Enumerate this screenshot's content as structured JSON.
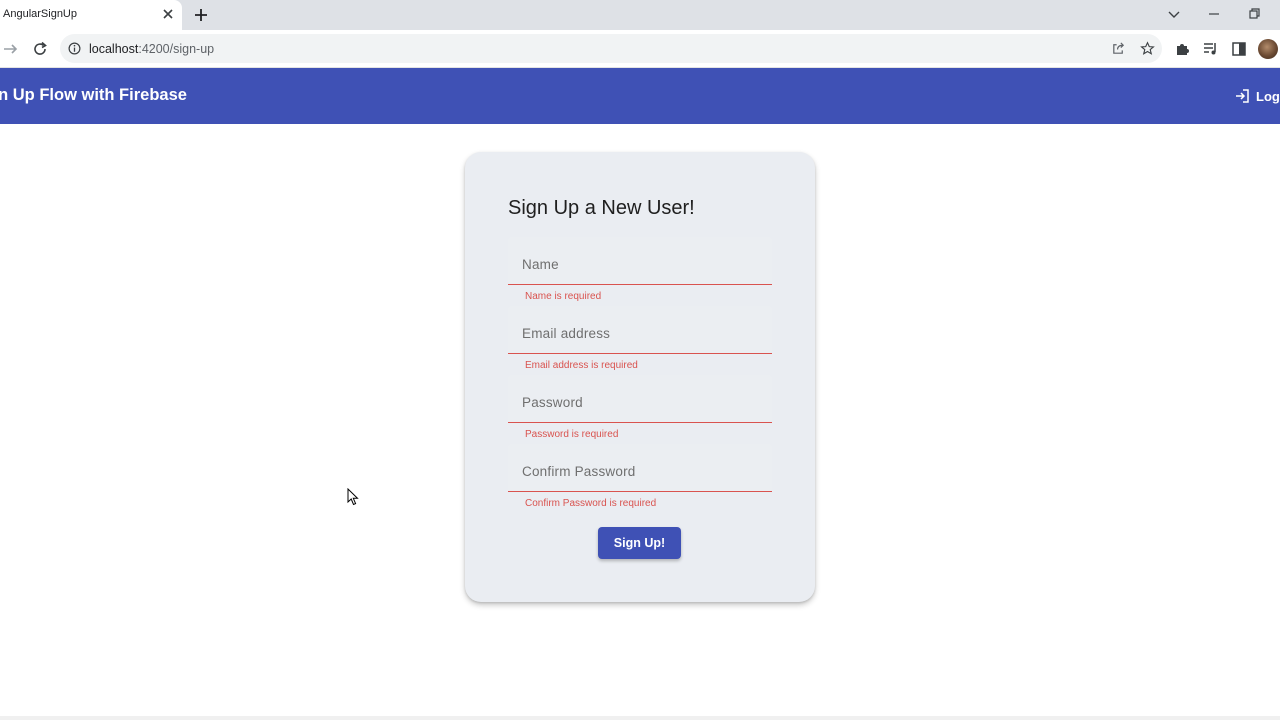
{
  "browser": {
    "tab_title": "AngularSignUp",
    "url_host": "localhost",
    "url_path": ":4200/sign-up"
  },
  "header": {
    "title": "gn Up Flow with Firebase",
    "login_label": "Log"
  },
  "card": {
    "title": "Sign Up a New User!",
    "fields": [
      {
        "placeholder": "Name",
        "error": "Name is required"
      },
      {
        "placeholder": "Email address",
        "error": "Email address is required"
      },
      {
        "placeholder": "Password",
        "error": "Password is required"
      },
      {
        "placeholder": "Confirm Password",
        "error": "Confirm Password is required"
      }
    ],
    "submit_label": "Sign Up!"
  },
  "colors": {
    "primary": "#3f51b5",
    "error": "#d9534f",
    "card_bg": "#eaedf2"
  },
  "icons": [
    "close-icon",
    "plus-icon",
    "forward-icon",
    "reload-icon",
    "info-icon",
    "share-icon",
    "star-icon",
    "puzzle-icon",
    "media-icon",
    "sidepanel-icon",
    "chevron-down-icon",
    "minimize-icon",
    "restore-icon",
    "login-icon",
    "mouse-cursor-icon"
  ]
}
